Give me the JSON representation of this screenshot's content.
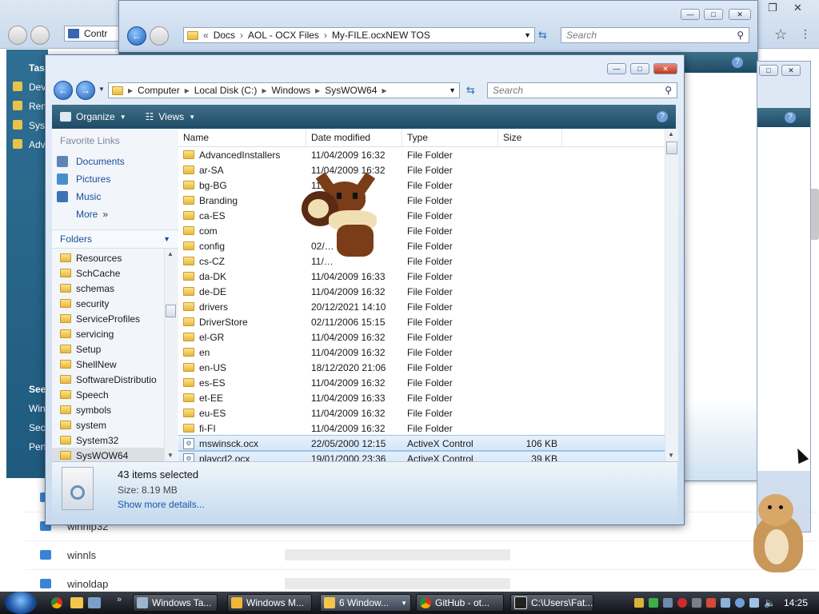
{
  "bg_browser": {
    "tab_text": "Contr",
    "sidebar_letters": [
      "Tas",
      "Dev",
      "Ren",
      "Syst",
      "Adv",
      "See",
      "Win",
      "Sec",
      "Perf"
    ],
    "list_items": [
      "winhlp32",
      "winnls",
      "winoldap"
    ]
  },
  "middle_window": {
    "breadcrumbs": [
      "Docs",
      "AOL - OCX Files",
      "My-FILE.ocxNEW TOS"
    ],
    "search_placeholder": "Search"
  },
  "explorer": {
    "breadcrumbs": [
      "Computer",
      "Local Disk (C:)",
      "Windows",
      "SysWOW64"
    ],
    "search_placeholder": "Search",
    "toolbar": {
      "organize": "Organize",
      "views": "Views"
    },
    "favorite_links_title": "Favorite Links",
    "favorites": [
      "Documents",
      "Pictures",
      "Music",
      "More"
    ],
    "folders_title": "Folders",
    "tree": [
      "Resources",
      "SchCache",
      "schemas",
      "security",
      "ServiceProfiles",
      "servicing",
      "Setup",
      "ShellNew",
      "SoftwareDistributio",
      "Speech",
      "symbols",
      "system",
      "System32",
      "SysWOW64"
    ],
    "columns": [
      "Name",
      "Date modified",
      "Type",
      "Size"
    ],
    "files": [
      {
        "name": "AdvancedInstallers",
        "date": "11/04/2009 16:32",
        "type": "File Folder",
        "size": ""
      },
      {
        "name": "ar-SA",
        "date": "11/04/2009 16:32",
        "type": "File Folder",
        "size": ""
      },
      {
        "name": "bg-BG",
        "date": "11/0…",
        "type": "File Folder",
        "size": ""
      },
      {
        "name": "Branding",
        "date": "",
        "type": "File Folder",
        "size": ""
      },
      {
        "name": "ca-ES",
        "date": "",
        "type": "File Folder",
        "size": ""
      },
      {
        "name": "com",
        "date": "",
        "type": "File Folder",
        "size": ""
      },
      {
        "name": "config",
        "date": "02/…",
        "type": "File Folder",
        "size": ""
      },
      {
        "name": "cs-CZ",
        "date": "11/…",
        "type": "File Folder",
        "size": ""
      },
      {
        "name": "da-DK",
        "date": "11/04/2009 16:33",
        "type": "File Folder",
        "size": ""
      },
      {
        "name": "de-DE",
        "date": "11/04/2009 16:32",
        "type": "File Folder",
        "size": ""
      },
      {
        "name": "drivers",
        "date": "20/12/2021 14:10",
        "type": "File Folder",
        "size": ""
      },
      {
        "name": "DriverStore",
        "date": "02/11/2006 15:15",
        "type": "File Folder",
        "size": ""
      },
      {
        "name": "el-GR",
        "date": "11/04/2009 16:32",
        "type": "File Folder",
        "size": ""
      },
      {
        "name": "en",
        "date": "11/04/2009 16:32",
        "type": "File Folder",
        "size": ""
      },
      {
        "name": "en-US",
        "date": "18/12/2020 21:06",
        "type": "File Folder",
        "size": ""
      },
      {
        "name": "es-ES",
        "date": "11/04/2009 16:32",
        "type": "File Folder",
        "size": ""
      },
      {
        "name": "et-EE",
        "date": "11/04/2009 16:33",
        "type": "File Folder",
        "size": ""
      },
      {
        "name": "eu-ES",
        "date": "11/04/2009 16:32",
        "type": "File Folder",
        "size": ""
      },
      {
        "name": "fi-FI",
        "date": "11/04/2009 16:32",
        "type": "File Folder",
        "size": ""
      },
      {
        "name": "mswinsck.ocx",
        "date": "22/05/2000 12:15",
        "type": "ActiveX Control",
        "size": "106 KB"
      },
      {
        "name": "playcd2.ocx",
        "date": "19/01/2000 23:36",
        "type": "ActiveX Control",
        "size": "39 KB"
      }
    ],
    "details": {
      "count": "43 items selected",
      "size": "Size: 8.19 MB",
      "more": "Show more details..."
    }
  },
  "taskbar": {
    "buttons": [
      "Windows Ta...",
      "Windows M...",
      "6 Window...",
      "GitHub - ot...",
      "C:\\Users\\Fat..."
    ],
    "clock": "14:25"
  }
}
